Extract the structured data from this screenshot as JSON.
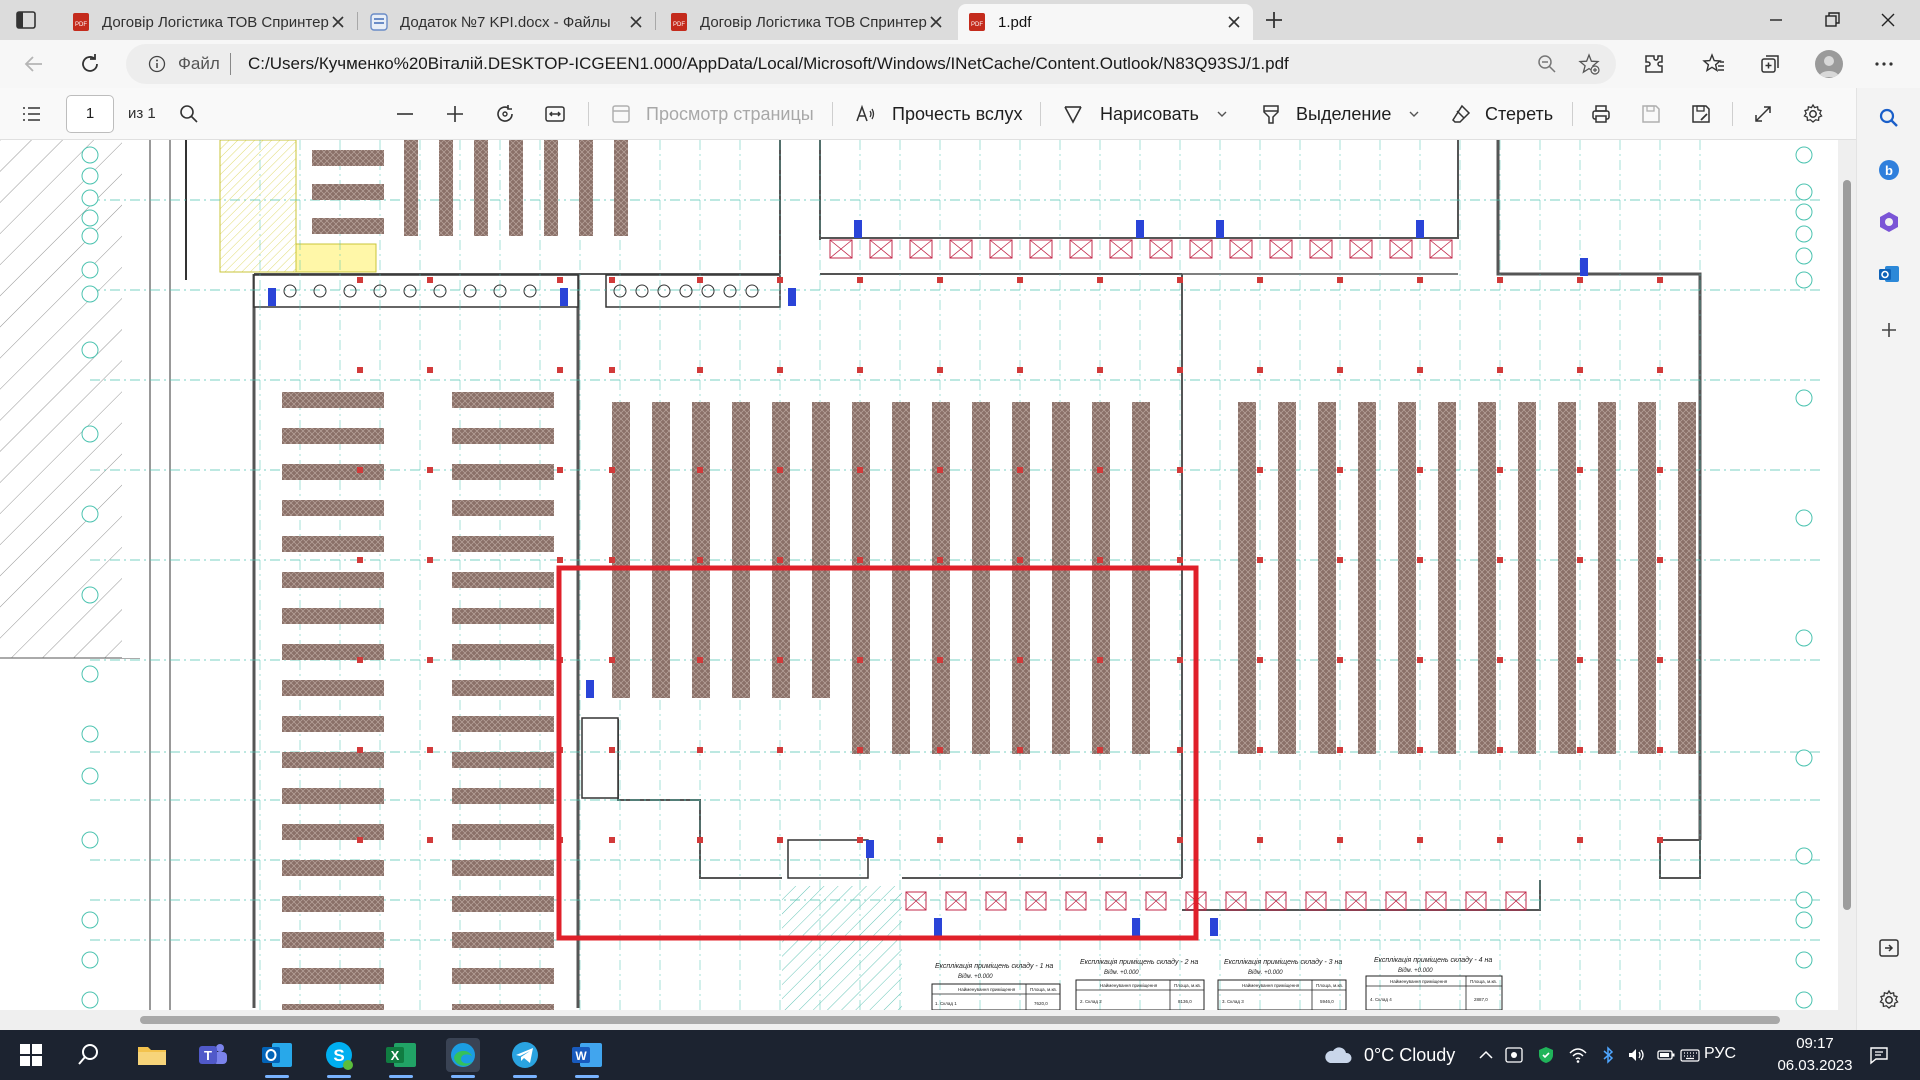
{
  "tabs": [
    {
      "title": "Договір Логістика ТОВ Спринтер",
      "icon": "pdf-icon",
      "active": false
    },
    {
      "title": "Додаток №7 KPI.docx - Файлы",
      "icon": "word-doc-icon",
      "active": false
    },
    {
      "title": "Договір Логістика ТОВ Спринтер",
      "icon": "pdf-icon",
      "active": false
    },
    {
      "title": "1.pdf",
      "icon": "pdf-icon",
      "active": true
    }
  ],
  "addressbar": {
    "scheme_label": "Файл",
    "url": "C:/Users/Кучменко%20Віталій.DESKTOP-ICGEEN1.000/AppData/Local/Microsoft/Windows/INetCache/Content.Outlook/N83Q93SJ/1.pdf"
  },
  "pdf_toolbar": {
    "page_number": "1",
    "page_count": "из 1",
    "page_view_label": "Просмотр страницы",
    "read_aloud_label": "Прочесть вслух",
    "draw_label": "Нарисовать",
    "highlight_label": "Выделение",
    "erase_label": "Стереть"
  },
  "drawing": {
    "legend_tables": [
      {
        "title": "Експлікація приміщень складу - 1 на",
        "subtitle": "Відм. +0.000",
        "col1": "Найменування приміщення",
        "col2": "Площа, м.кв.",
        "row_name": "1. Склад 1",
        "row_area": "7620,0"
      },
      {
        "title": "Експлікація приміщень складу - 2 на",
        "subtitle": "Відм. +0.000",
        "col1": "Найменування приміщення",
        "col2": "Площа, м.кв.",
        "row_name": "2. Склад 2",
        "row_area": "8136,0"
      },
      {
        "title": "Експлікація приміщень складу - 3 на",
        "subtitle": "Відм. +0.000",
        "col1": "Найменування приміщення",
        "col2": "Площа, м.кв.",
        "row_name": "3. Склад 3",
        "row_area": "5946,0"
      },
      {
        "title": "Експлікація приміщень складу - 4 на",
        "subtitle": "Відм. +0.000",
        "col1": "Найменування приміщення",
        "col2": "Площа, м.кв.",
        "row_name": "4. Склад 4",
        "row_area": "2887,0"
      }
    ],
    "highlight_color": "#e0202a",
    "rack_color": "#8a7068",
    "grid_color": "#4cc3b0"
  },
  "taskbar": {
    "weather": "0°C  Cloudy",
    "language": "РУС",
    "time": "09:17",
    "date": "06.03.2023",
    "apps": [
      "file-explorer-icon",
      "teams-icon",
      "outlook-icon",
      "skype-icon",
      "excel-icon",
      "edge-icon",
      "telegram-icon",
      "word-icon"
    ]
  }
}
